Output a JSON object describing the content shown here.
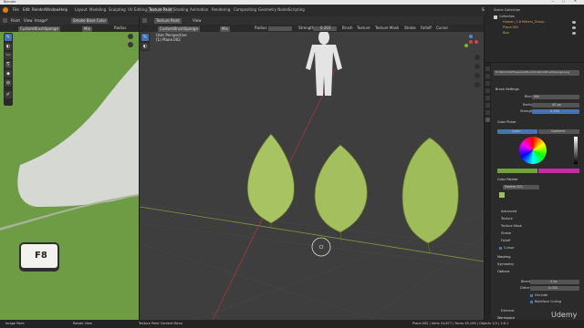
{
  "window": {
    "title": "Blender",
    "minimize": "—",
    "maximize": "□",
    "close": "✕"
  },
  "menubar": {
    "items": [
      "File",
      "Edit",
      "Render",
      "Window",
      "Help"
    ],
    "workspaces": [
      "Layout",
      "Modeling",
      "Sculpting",
      "UV Editing",
      "Texture Paint",
      "Shading",
      "Animation",
      "Rendering",
      "Compositing",
      "Geometry Nodes",
      "Scripting"
    ],
    "active_workspace": "Texture Paint",
    "scene_label": "Scene",
    "viewlayer_label": "ViewLayer"
  },
  "image_editor": {
    "header_items": [
      "Paint",
      "View",
      "Image*"
    ],
    "image_name": "Smoke Base Color",
    "brush_name": "CustomBrushSponge",
    "blend": "Mix",
    "radius_label": "Radius",
    "key_label": "F8"
  },
  "viewport": {
    "mode": "Texture Paint",
    "view_menu": "View",
    "brush_name": "CustomBrushSponge",
    "blend": "Mix",
    "radius_label": "Radius",
    "radius_value": "",
    "strength_label": "Strength",
    "strength_value": "0.203",
    "header_menus": [
      "Brush",
      "Texture",
      "Texture Mask",
      "Stroke",
      "Falloff",
      "Cursor"
    ],
    "overlay_line1": "User Perspective",
    "overlay_line2": "(1) Plane.002"
  },
  "outliner": {
    "title": "Scene Collection",
    "items": [
      "Collection",
      "Human_1.8 Meters_Group",
      "Plane.002",
      "Sun"
    ]
  },
  "properties": {
    "brush_path": "D:\\Work\\2023\\Leaves\\Brush\\CustomBrushSponge.png",
    "brush_settings": "Brush Settings",
    "blend_label": "Blend",
    "blend_value": "Mix",
    "radius_label": "Radius",
    "radius_value": "40 px",
    "strength_label": "Strength",
    "strength_value": "0.203",
    "color_picker": "Color Picker",
    "color_tab": "Color",
    "gradient_tab": "Gradient",
    "color_palette": "Color Palette",
    "palette_name": "Palette.001",
    "subsections": [
      "Advanced",
      "Texture",
      "Texture Mask",
      "Stroke",
      "Falloff",
      "Cursor"
    ],
    "masking": "Masking",
    "symmetry": "Symmetry",
    "options": "Options",
    "bleed_label": "Bleed",
    "bleed_value": "2 px",
    "dither_label": "Dither",
    "dither_value": "0.000",
    "occlude_label": "Occlude",
    "backface_label": "Backface Culling",
    "external": "External",
    "workspace": "Workspace",
    "accent": "#4772b3"
  },
  "statusbar": {
    "left_items": [
      "Image Paint",
      "Rotate View",
      "Texture Paint Context Menu"
    ],
    "right_text": "Plane.002 | Verts 24,877 | Faces 49,156 | Objects 1/3 | 3.6.1"
  },
  "watermark": "Udemy"
}
